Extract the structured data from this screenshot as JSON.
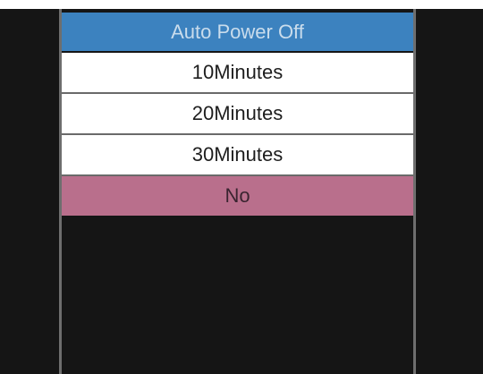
{
  "menu": {
    "title": "Auto Power Off",
    "items": [
      {
        "label": "10Minutes"
      },
      {
        "label": "20Minutes"
      },
      {
        "label": "30Minutes"
      },
      {
        "label": "No"
      }
    ],
    "selected_label": "No"
  },
  "colors": {
    "screen_background": "#151515",
    "title_background": "#3c82bf",
    "item_background": "#ffffff",
    "selected_background": "#b96f8c",
    "divider": "#6e6e6e"
  }
}
